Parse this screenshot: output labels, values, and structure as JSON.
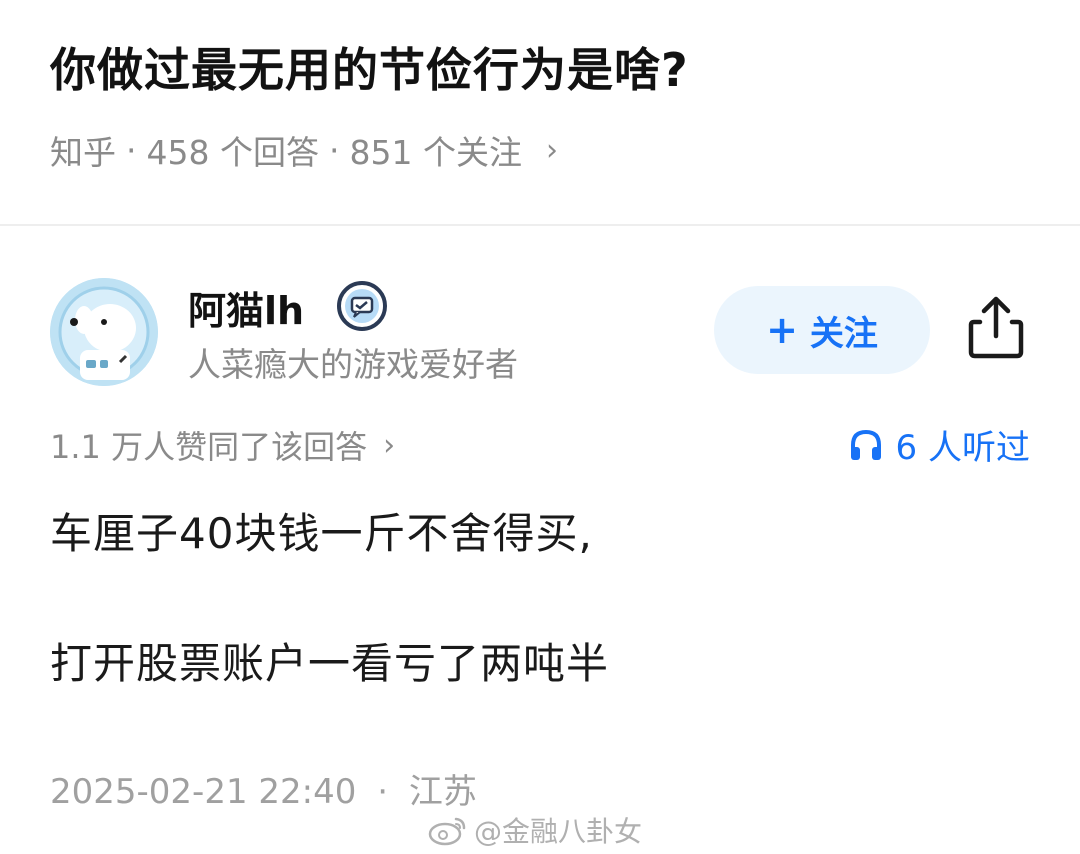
{
  "question": {
    "title": "你做过最无用的节俭行为是啥?",
    "source": "知乎",
    "answer_count": "458 个回答",
    "follow_count": "851 个关注",
    "separator": "·",
    "chevron": "›"
  },
  "author": {
    "name": "阿猫lh",
    "bio": "人菜瘾大的游戏爱好者",
    "avatar_icon": "cartoon-dog-astronaut-avatar",
    "badge_icon": "verified-chat-badge-icon",
    "follow_label": "关注",
    "follow_plus": "+",
    "share_icon": "share-icon"
  },
  "answer_meta": {
    "votes": "1.1 万人赞同了该回答",
    "chevron": "›",
    "listen_icon": "headphones-icon",
    "listeners": "6 人听过"
  },
  "answer": {
    "paragraphs": [
      "车厘子40块钱一斤不舍得买,",
      "打开股票账户一看亏了两吨半"
    ],
    "date": "2025-02-21 22:40",
    "separator": "·",
    "location": "江苏"
  },
  "watermark": {
    "icon": "weibo-logo-icon",
    "text": "@金融八卦女"
  },
  "colors": {
    "accent": "#1772f6",
    "follow_bg": "#ebf5fd",
    "meta_text": "#8a8a8a",
    "title_text": "#121212"
  }
}
